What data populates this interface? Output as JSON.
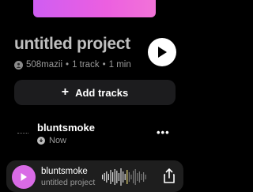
{
  "project": {
    "title": "untitled project",
    "owner": "508mazii",
    "track_count": "1 track",
    "duration": "1 min",
    "separator": "•"
  },
  "actions": {
    "add_tracks_label": "Add tracks"
  },
  "tracks": [
    {
      "name": "bluntsmoke",
      "status": "Now"
    }
  ],
  "mini_player": {
    "title": "bluntsmoke",
    "subtitle": "untitled project •"
  },
  "colors": {
    "background": "#000000",
    "accent": "#d96be6",
    "artwork_gradient": [
      "#cf5df2",
      "#f273d8"
    ]
  }
}
